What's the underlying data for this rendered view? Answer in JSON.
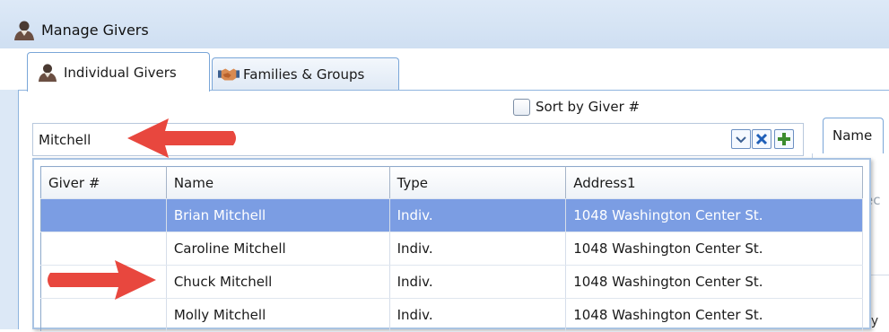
{
  "window": {
    "title": "Manage Givers",
    "icon": "person-icon"
  },
  "tabs": [
    {
      "label": "Individual Givers",
      "icon": "person-icon",
      "active": true
    },
    {
      "label": "Families & Groups",
      "icon": "handshake-icon",
      "active": false
    }
  ],
  "sort_option": {
    "label": "Sort by Giver #",
    "checked": false
  },
  "search": {
    "value": "Mitchell"
  },
  "right_panel": {
    "tab_label": "Name",
    "partial_text_1": "ec",
    "partial_text_2": "dy"
  },
  "results": {
    "columns": [
      "Giver #",
      "Name",
      "Type",
      "Address1"
    ],
    "rows": [
      {
        "giver": "",
        "name": "Brian Mitchell",
        "type": "Indiv.",
        "address": "1048 Washington Center St.",
        "selected": true
      },
      {
        "giver": "",
        "name": "Caroline Mitchell",
        "type": "Indiv.",
        "address": "1048 Washington Center St.",
        "selected": false
      },
      {
        "giver": "",
        "name": "Chuck Mitchell",
        "type": "Indiv.",
        "address": "1048 Washington Center St.",
        "selected": false
      },
      {
        "giver": "",
        "name": "Molly Mitchell",
        "type": "Indiv.",
        "address": "1048 Washington Center St.",
        "selected": false
      }
    ]
  },
  "colors": {
    "selection": "#7b9de3",
    "annotation_arrow": "#e8473e",
    "accent_border": "#7aa6d8"
  }
}
